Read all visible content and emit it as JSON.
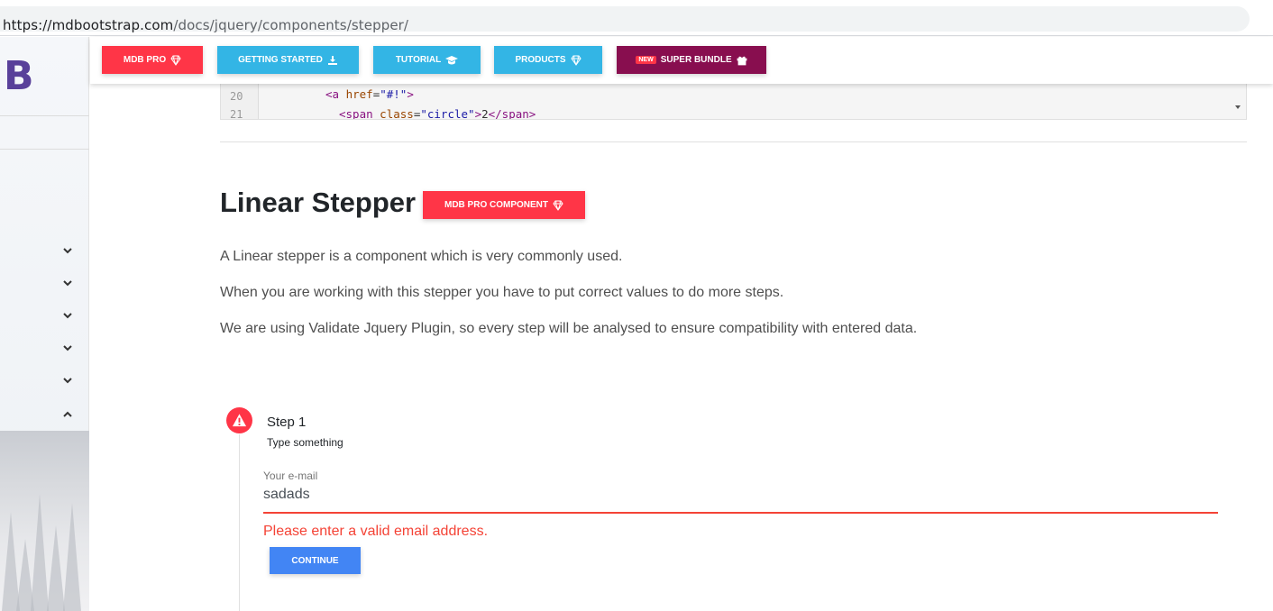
{
  "browser": {
    "url_host": "https://mdbootstrap.com",
    "url_path": "/docs/jquery/components/stepper/"
  },
  "sidebar": {
    "logo": "B",
    "chevrons": [
      "chevron-down-icon",
      "chevron-down-icon",
      "chevron-down-icon",
      "chevron-down-icon",
      "chevron-down-icon",
      "chevron-up-icon"
    ]
  },
  "topnav": {
    "buttons": [
      {
        "label": "MDB PRO",
        "icon": "gem-icon",
        "color": "#ff3547"
      },
      {
        "label": "GETTING STARTED",
        "icon": "download-icon",
        "color": "#33b5e5"
      },
      {
        "label": "TUTORIAL",
        "icon": "graduation-cap-icon",
        "color": "#33b5e5"
      },
      {
        "label": "PRODUCTS",
        "icon": "gem-icon",
        "color": "#33b5e5"
      },
      {
        "label": "SUPER BUNDLE",
        "badge": "NEW",
        "icon": "gift-icon",
        "color": "#880e4f"
      }
    ]
  },
  "code": {
    "lines": [
      {
        "number": "20",
        "text": "<a href=\"#!\">"
      },
      {
        "number": "21",
        "text": "<span class=\"circle\">2</span>"
      }
    ]
  },
  "section": {
    "title": "Linear Stepper",
    "badge": "MDB PRO COMPONENT",
    "paragraphs": [
      "A Linear stepper is a component which is very commonly used.",
      "When you are working with this stepper you have to put correct values to do more steps.",
      "We are using Validate Jquery Plugin, so every step will be analysed to ensure compatibility with entered data."
    ]
  },
  "stepper": {
    "step_title": "Step 1",
    "step_subtitle": "Type something",
    "email_label": "Your e-mail",
    "email_value": "sadads",
    "error_message": "Please enter a valid email address.",
    "continue_label": "CONTINUE",
    "accent_error": "#f44336",
    "accent_primary": "#4285f4"
  }
}
